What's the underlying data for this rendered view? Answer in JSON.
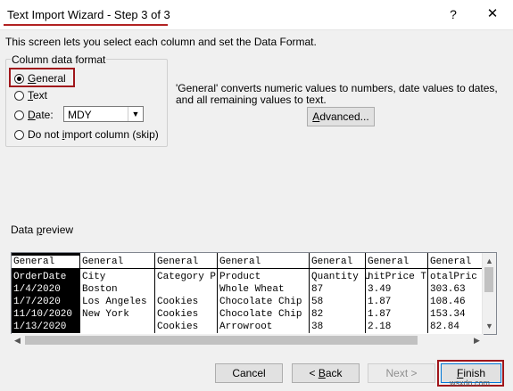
{
  "window": {
    "title": "Text Import Wizard - Step 3 of 3",
    "help": "?",
    "close": "✕"
  },
  "description": "This screen lets you select each column and set the Data Format.",
  "column_format": {
    "legend": "Column data format",
    "options": [
      {
        "pre": "",
        "u": "G",
        "post": "eneral",
        "checked": true
      },
      {
        "pre": "",
        "u": "T",
        "post": "ext",
        "checked": false
      },
      {
        "pre": "",
        "u": "D",
        "post": "ate:",
        "checked": false
      },
      {
        "pre": "Do not ",
        "u": "i",
        "post": "mport column (skip)",
        "checked": false
      }
    ],
    "date_value": "MDY"
  },
  "info_text": "'General' converts numeric values to numbers, date values to dates, and all remaining values to text.",
  "advanced": {
    "u": "A",
    "post": "dvanced..."
  },
  "preview": {
    "label_pre": "Data ",
    "label_u": "p",
    "label_post": "review",
    "columns": [
      {
        "header": "General",
        "cells": [
          "OrderDate",
          "1/4/2020",
          "1/7/2020",
          "11/10/2020",
          "1/13/2020"
        ]
      },
      {
        "header": "General",
        "cells": [
          "City",
          "Boston",
          "Los Angeles",
          "New York",
          ""
        ]
      },
      {
        "header": "General",
        "cells": [
          "Category P",
          "",
          "Cookies",
          "Cookies",
          "Cookies"
        ]
      },
      {
        "header": "General",
        "cells": [
          "Product",
          "Whole Wheat",
          "Chocolate Chip",
          "Chocolate Chip",
          "Arrowroot"
        ]
      },
      {
        "header": "General",
        "cells": [
          "Quantity U",
          "87",
          "58",
          "82",
          "38"
        ]
      },
      {
        "header": "General",
        "cells": [
          "nitPrice T",
          "3.49",
          "1.87",
          "1.87",
          "2.18"
        ]
      },
      {
        "header": "General",
        "cells": [
          "otalPric",
          "303.63",
          "108.46",
          "153.34",
          "82.84"
        ]
      }
    ]
  },
  "buttons": {
    "cancel": "Cancel",
    "back_pre": "< ",
    "back_u": "B",
    "back_post": "ack",
    "next": "Next >",
    "finish_u": "F",
    "finish_post": "inish"
  },
  "watermark": "wsxdn.com"
}
